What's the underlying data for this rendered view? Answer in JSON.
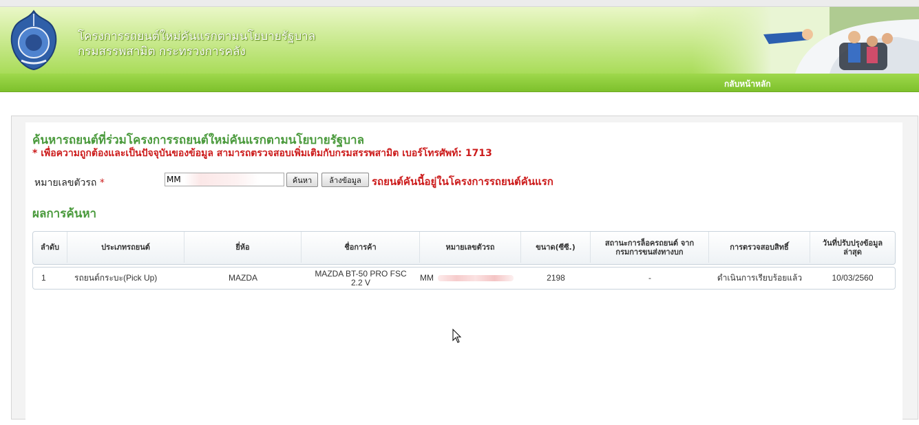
{
  "header": {
    "title_line1": "โครงการรถยนต์ใหม่คันแรกตามนโยบายรัฐบาล",
    "title_line2": "กรมสรรพสามิต กระทรวงการคลัง",
    "nav_home": "กลับหน้าหลัก"
  },
  "page": {
    "title": "ค้นหารถยนต์ที่ร่วมโครงการรถยนต์ใหม่คันแรกตามนโยบายรัฐบาล",
    "notice": "* เพื่อความถูกต้องและเป็นปัจจุบันของข้อมูล สามารถตรวจสอบเพิ่มเติมกับกรมสรรพสามิต เบอร์โทรศัพท์: 1713"
  },
  "form": {
    "plate_label": "หมายเลขตัวรถ",
    "required_mark": "*",
    "plate_value": "MM",
    "search_button": "ค้นหา",
    "clear_button": "ล้างข้อมูล",
    "status_message": "รถยนต์คันนี้อยู่ในโครงการรถยนต์คันแรก"
  },
  "results": {
    "title": "ผลการค้นหา",
    "columns": [
      "ลำดับ",
      "ประเภทรถยนต์",
      "ยี่ห้อ",
      "ชื่อการค้า",
      "หมายเลขตัวรถ",
      "ขนาด(ซีซี.)",
      "สถานะการล็อครถยนต์ จากกรมการขนส่งทางบก",
      "การตรวจสอบสิทธิ์",
      "วันที่ปรับปรุงข้อมูล ล่าสุด"
    ],
    "rows": [
      {
        "no": "1",
        "type": "รถยนต์กระบะ(Pick Up)",
        "brand": "MAZDA",
        "trade_name": "MAZDA BT-50 PRO FSC 2.2 V",
        "plate": "MM",
        "cc": "2198",
        "lock_status": "-",
        "rights_check": "ดำเนินการเรียบร้อยแล้ว",
        "updated": "10/03/2560"
      }
    ]
  },
  "colors": {
    "title_green": "#4a9a3c",
    "alert_red": "#cc1b1b",
    "nav_green": "#7dc12c"
  }
}
